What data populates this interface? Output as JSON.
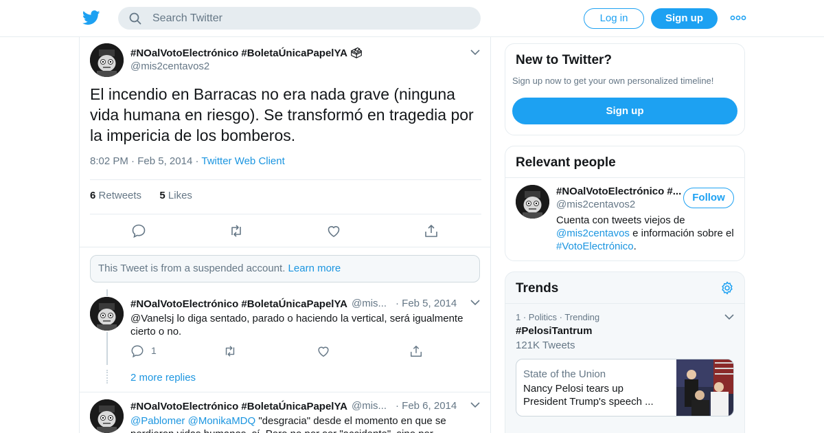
{
  "header": {
    "search_placeholder": "Search Twitter",
    "login_label": "Log in",
    "signup_label": "Sign up"
  },
  "tweet": {
    "display_name": "#NOalVotoElectrónico #BoletaÚnicaPapelYA 🗳",
    "handle": "@mis2centavos2",
    "text": "El incendio en Barracas no era nada grave (ninguna vida humana en riesgo). Se transformó en tragedia por la impericia de los bomberos.",
    "time": "8:02 PM",
    "date": "Feb 5, 2014",
    "client": "Twitter Web Client",
    "retweets_count": "6",
    "retweets_label": "Retweets",
    "likes_count": "5",
    "likes_label": "Likes"
  },
  "suspended": {
    "text": "This Tweet is from a suspended account.",
    "link": "Learn more"
  },
  "replies": [
    {
      "display_name": "#NOalVotoElectrónico #BoletaÚnicaPapelYA 🗳",
      "handle": "@mis...",
      "date": "Feb 5, 2014",
      "text": "@Vanelsj lo diga sentado, parado o haciendo la vertical, será igualmente cierto o no.",
      "reply_count": "1"
    },
    {
      "display_name": "#NOalVotoElectrónico #BoletaÚnicaPapelYA 🗳",
      "handle": "@mis...",
      "date": "Feb 6, 2014",
      "mention1": "@Pablomer",
      "mention2": "@MonikaMDQ",
      "text_line1": " \"desgracia\" desde el momento en que se",
      "text_line2": "perdieron vidas humanas, sí. Pero no por ser \"accidente\", sino por"
    }
  ],
  "more_replies": "2 more replies",
  "new_to_twitter": {
    "title": "New to Twitter?",
    "subtitle": "Sign up now to get your own personalized timeline!",
    "button": "Sign up"
  },
  "relevant_people": {
    "title": "Relevant people",
    "name": "#NOalVotoElectrónico #...",
    "handle": "@mis2centavos2",
    "follow": "Follow",
    "bio_prefix": "Cuenta con tweets viejos de ",
    "bio_link1": "@mis2centavos",
    "bio_mid": " e información sobre el ",
    "bio_link2": "#VotoElectrónico",
    "bio_suffix": "."
  },
  "trends": {
    "title": "Trends",
    "item": {
      "rank": "1",
      "category": "Politics",
      "status": "Trending",
      "name": "#PelosiTantrum",
      "count": "121K Tweets"
    },
    "news": {
      "source": "State of the Union",
      "title": "Nancy Pelosi tears up President Trump's speech ..."
    }
  },
  "colors": {
    "accent": "#1da1f2",
    "link": "#1b95e0",
    "text": "#14171a",
    "muted": "#657786",
    "border": "#e6ecf0"
  },
  "icons": [
    "twitter-bird-icon",
    "search-icon",
    "more-dots-icon",
    "chevron-down-icon",
    "reply-icon",
    "retweet-icon",
    "like-icon",
    "share-icon",
    "gear-icon"
  ]
}
